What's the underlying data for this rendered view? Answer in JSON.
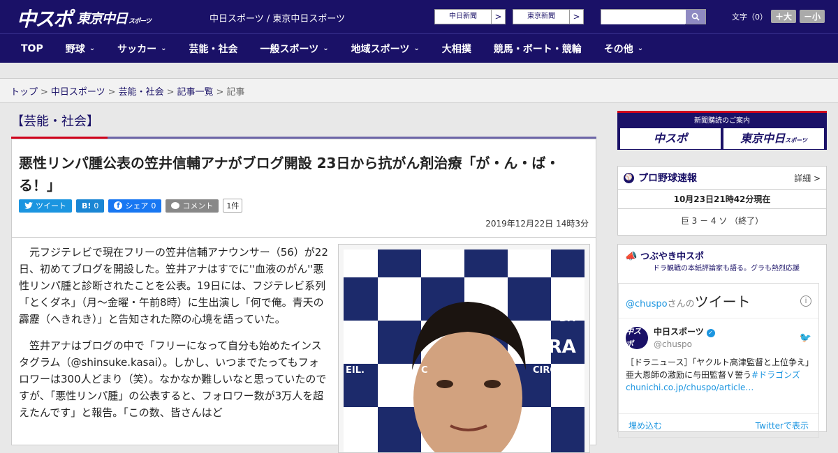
{
  "header": {
    "logo_main": "中スポ",
    "logo_tokyo": "東京中日",
    "logo_tokyo_sub": "スポーツ",
    "site_name": "中日スポーツ / 東京中日スポーツ",
    "ext_links": [
      {
        "label": "中日新聞",
        "arrow": ">"
      },
      {
        "label": "東京新聞",
        "arrow": ">"
      }
    ],
    "search": {
      "placeholder": ""
    },
    "font_label": "文字（0）",
    "font_larger": "＋大",
    "font_smaller": "－小"
  },
  "nav": {
    "items": [
      {
        "label": "TOP",
        "dropdown": false
      },
      {
        "label": "野球",
        "dropdown": true
      },
      {
        "label": "サッカー",
        "dropdown": true
      },
      {
        "label": "芸能・社会",
        "dropdown": false
      },
      {
        "label": "一般スポーツ",
        "dropdown": true
      },
      {
        "label": "地域スポーツ",
        "dropdown": true
      },
      {
        "label": "大相撲",
        "dropdown": false
      },
      {
        "label": "競馬・ボート・競輪",
        "dropdown": false
      },
      {
        "label": "その他",
        "dropdown": true
      }
    ]
  },
  "breadcrumb": {
    "items": [
      "トップ",
      "中日スポーツ",
      "芸能・社会",
      "記事一覧"
    ],
    "current": "記事",
    "sep": ">"
  },
  "category_label": "【芸能・社会】",
  "article": {
    "title": "悪性リンパ腫公表の笠井信輔アナがブログ開設 23日から抗がん剤治療「が・ん・ば・る！」",
    "social": {
      "tweet": "ツイート",
      "hatena": "B!",
      "hatena_count": "0",
      "share": "シェア",
      "share_count": "0",
      "comment": "コメント",
      "comment_count": "1件"
    },
    "date": "2019年12月22日 14時3分",
    "paragraphs": [
      "元フジテレビで現在フリーの笠井信輔アナウンサー（56）が22日、初めてブログを開設した。笠井アナはすでに''血液のがん''悪性リンパ腫と診断されたことを公表。19日には、フジテレビ系列「とくダネ」（月～金曜・午前8時）に生出演し「何で俺。青天の霹靂（へきれき）」と告知された際の心境を語っていた。",
      "笠井アナはブログの中で「フリーになって自分も始めたインスタグラム（@shinsuke.kasai）。しかし、いつまでたってもフォロワーは300人どまり（笑）。なかなか難しいなと思っていたのですが、「悪性リンパ腫」の公表すると、フォロワー数が3万人を超えたんです」と報告。「この数、皆さんはど"
    ],
    "photo_text": [
      "DA",
      "DRA",
      "CIRQUE",
      "N",
      "EIL.",
      "C"
    ]
  },
  "sidebar": {
    "banner": {
      "label": "新聞購読のご案内",
      "left": "中スポ",
      "right": "東京中日",
      "right_sub": "スポーツ"
    },
    "baseball": {
      "title": "プロ野球速報",
      "more": "詳細 >",
      "time": "10月23日21時42分現在",
      "score": "巨 3 － 4 ソ （終了）"
    },
    "tweets": {
      "title": "つぶやき中スポ",
      "subtitle": "ドラ観戦の本紙評論家も語る。グラも熱烈応援",
      "handle_prefix": "@chuspo",
      "handle_suffix": "さんの",
      "heading": "ツイート",
      "account_name": "中日スポーツ",
      "account_handle": "@chuspo",
      "avatar_text": "中スポ",
      "text": "［ドラニュース］「ヤクルト高津監督と上位争え」亜大恩師の激励に与田監督Ｖ誓う",
      "hashtag": "#ドラゴンズ",
      "link": "chunichi.co.jp/chuspo/article…",
      "embed": "埋め込む",
      "view": "Twitterで表示"
    }
  },
  "colors": {
    "brand": "#1a1167",
    "accent": "#d0021b",
    "twitter": "#1b95e0"
  }
}
